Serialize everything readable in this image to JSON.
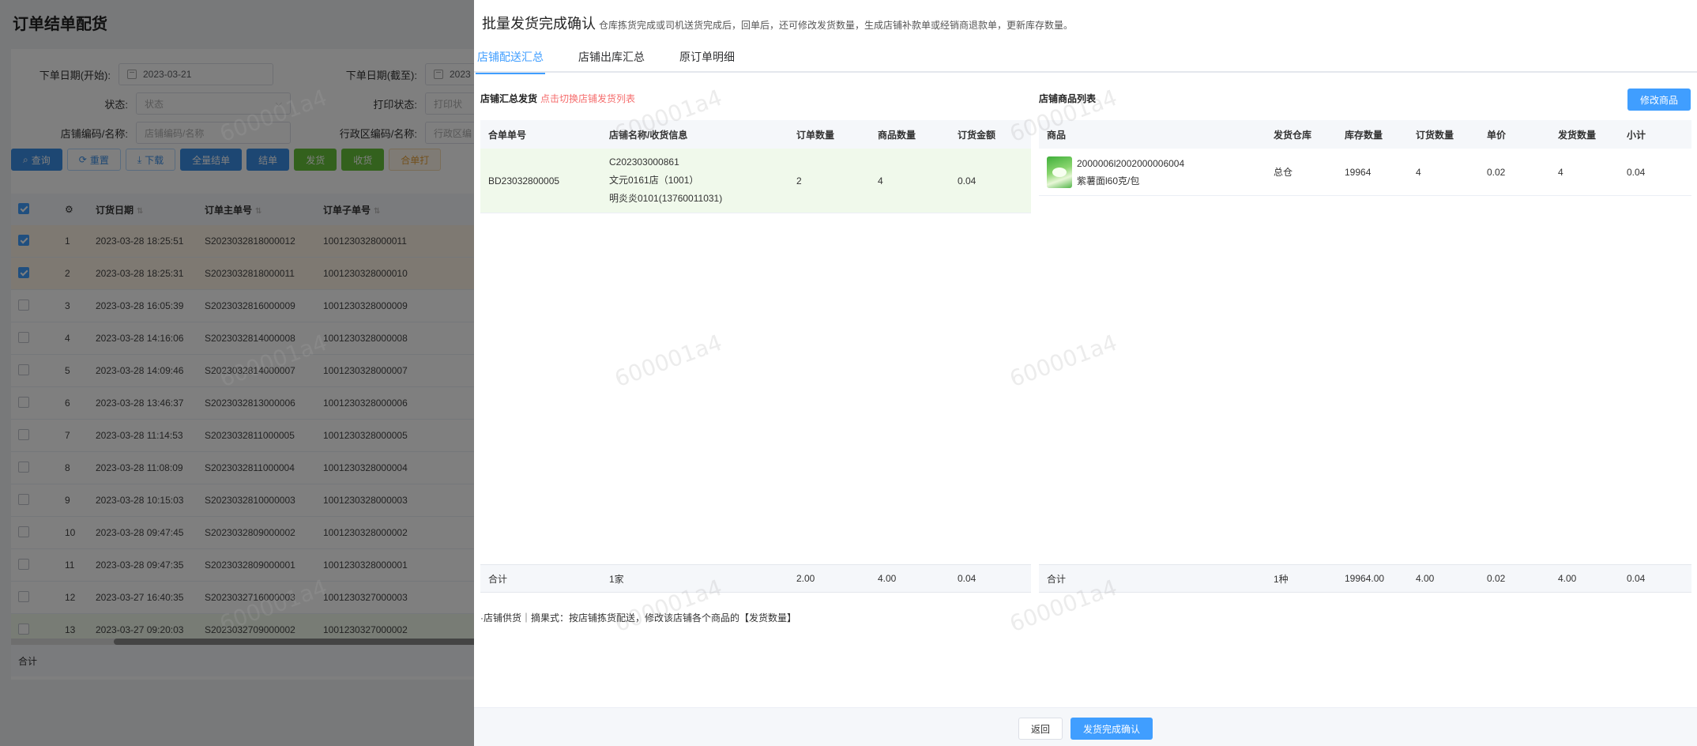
{
  "background": {
    "title": "订单结单配货",
    "filters": {
      "start_date_label": "下单日期(开始):",
      "start_date_value": "2023-03-21",
      "end_date_label": "下单日期(截至):",
      "end_date_value": "2023",
      "status_label": "状态:",
      "status_placeholder": "状态",
      "print_status_label": "打印状态:",
      "print_status_placeholder": "打印状",
      "store_label": "店铺编码/名称:",
      "store_placeholder": "店铺编码/名称",
      "region_label": "行政区编码/名称:",
      "region_placeholder": "行政区编"
    },
    "buttons": {
      "query": "查询",
      "reset": "重置",
      "download": "下载",
      "settle_all": "全量结单",
      "settle": "结单",
      "ship": "发货",
      "receive": "收货",
      "merge": "合单打"
    },
    "table": {
      "headers": {
        "date": "订货日期",
        "main": "订单主单号",
        "sub": "订单子单号"
      },
      "rows": [
        {
          "no": "1",
          "date": "2023-03-28 18:25:51",
          "main": "S2023032818000012",
          "sub": "1001230328000011",
          "checked": true
        },
        {
          "no": "2",
          "date": "2023-03-28 18:25:31",
          "main": "S2023032818000011",
          "sub": "1001230328000010",
          "checked": true
        },
        {
          "no": "3",
          "date": "2023-03-28 16:05:39",
          "main": "S2023032816000009",
          "sub": "1001230328000009",
          "checked": false
        },
        {
          "no": "4",
          "date": "2023-03-28 14:16:06",
          "main": "S2023032814000008",
          "sub": "1001230328000008",
          "checked": false
        },
        {
          "no": "5",
          "date": "2023-03-28 14:09:46",
          "main": "S2023032814000007",
          "sub": "1001230328000007",
          "checked": false
        },
        {
          "no": "6",
          "date": "2023-03-28 13:46:37",
          "main": "S2023032813000006",
          "sub": "1001230328000006",
          "checked": false
        },
        {
          "no": "7",
          "date": "2023-03-28 11:14:53",
          "main": "S2023032811000005",
          "sub": "1001230328000005",
          "checked": false
        },
        {
          "no": "8",
          "date": "2023-03-28 11:08:09",
          "main": "S2023032811000004",
          "sub": "1001230328000004",
          "checked": false
        },
        {
          "no": "9",
          "date": "2023-03-28 10:15:03",
          "main": "S2023032810000003",
          "sub": "1001230328000003",
          "checked": false
        },
        {
          "no": "10",
          "date": "2023-03-28 09:47:45",
          "main": "S2023032809000002",
          "sub": "1001230328000002",
          "checked": false
        },
        {
          "no": "11",
          "date": "2023-03-28 09:47:35",
          "main": "S2023032809000001",
          "sub": "1001230328000001",
          "checked": false
        },
        {
          "no": "12",
          "date": "2023-03-27 16:40:35",
          "main": "S2023032716000003",
          "sub": "1001230327000003",
          "checked": false
        },
        {
          "no": "13",
          "date": "2023-03-27 09:20:03",
          "main": "S2023032709000002",
          "sub": "1001230327000002",
          "checked": false
        }
      ],
      "total_label": "合计"
    }
  },
  "drawer": {
    "title": "批量发货完成确认",
    "subtitle": "仓库拣货完成或司机送货完成后，回单后，还可修改发货数量，生成店铺补款单或经销商退款单，更新库存数量。",
    "tabs": [
      {
        "label": "店铺配送汇总",
        "active": true
      },
      {
        "label": "店铺出库汇总",
        "active": false
      },
      {
        "label": "原订单明细",
        "active": false
      }
    ],
    "left": {
      "title": "店铺汇总发货",
      "hint": "点击切换店铺发货列表",
      "headers": [
        "合单单号",
        "店铺名称/收货信息",
        "订单数量",
        "商品数量",
        "订货金额"
      ],
      "row": {
        "order_no": "BD23032800005",
        "store_code": "C202303000861",
        "store_name": "文元0161店（1001）",
        "receiver": "明炎炎0101(13760011031)",
        "order_qty": "2",
        "goods_qty": "4",
        "amount": "0.04"
      },
      "footer": {
        "label": "合计",
        "stores": "1家",
        "order_qty": "2.00",
        "goods_qty": "4.00",
        "amount": "0.04"
      }
    },
    "right": {
      "title": "店铺商品列表",
      "edit_button": "修改商品",
      "headers": [
        "商品",
        "发货仓库",
        "库存数量",
        "订货数量",
        "单价",
        "发货数量",
        "小计"
      ],
      "row": {
        "code": "2000006l2002000006004",
        "name": "紫薯面l60克/包",
        "warehouse": "总仓",
        "stock": "19964",
        "order_qty": "4",
        "price": "0.02",
        "ship_qty": "4",
        "subtotal": "0.04"
      },
      "footer": {
        "label": "合计",
        "kinds": "1种",
        "stock": "19964.00",
        "order_qty": "4.00",
        "price": "0.02",
        "ship_qty": "4.00",
        "subtotal": "0.04"
      }
    },
    "note": "·店铺供货｜摘果式：按店铺拣货配送，修改该店铺各个商品的【发货数量】",
    "back_button": "返回",
    "confirm_button": "发货完成确认"
  },
  "watermark": "600001a4",
  "colors": {
    "primary": "#409eff",
    "danger": "#f56c6c",
    "success": "#67c23a"
  }
}
